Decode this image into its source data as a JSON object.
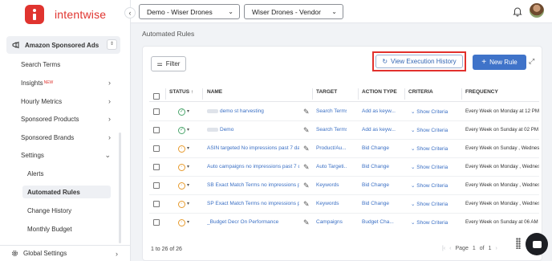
{
  "brand": {
    "name": "intentwise",
    "color": "#e0342f"
  },
  "sidebar": {
    "section_title": "Amazon Sponsored Ads",
    "items": [
      {
        "label": "Search Terms",
        "badge": "",
        "has_chevron": false
      },
      {
        "label": "Insights",
        "badge": "NEW",
        "has_chevron": true
      },
      {
        "label": "Hourly Metrics",
        "badge": "",
        "has_chevron": true
      },
      {
        "label": "Sponsored Products",
        "badge": "",
        "has_chevron": true
      },
      {
        "label": "Sponsored Brands",
        "badge": "",
        "has_chevron": true
      },
      {
        "label": "Settings",
        "badge": "",
        "has_chevron": true
      }
    ],
    "settings_subitems": [
      {
        "label": "Alerts",
        "active": false
      },
      {
        "label": "Automated Rules",
        "active": true
      },
      {
        "label": "Change History",
        "active": false
      },
      {
        "label": "Monthly Budget",
        "active": false
      }
    ],
    "bottom": {
      "label": "Global Settings"
    }
  },
  "topbar": {
    "account_select": "Demo - Wiser Drones",
    "profile_select": "Wiser Drones - Vendor"
  },
  "page": {
    "title": "Automated Rules"
  },
  "toolbar": {
    "filter_label": "Filter",
    "exec_history_label": "View Execution History",
    "new_rule_label": "New Rule",
    "accent": "#3f73c9",
    "highlight_color": "#e2312d"
  },
  "table": {
    "headers": {
      "status": "STATUS",
      "name": "NAME",
      "target": "TARGET",
      "action_type": "ACTION TYPE",
      "criteria": "CRITERIA",
      "frequency": "FREQUENCY"
    },
    "rows": [
      {
        "status": "check",
        "name": "demo st harvesting",
        "target": "Search Terms",
        "action": "Add as keyw...",
        "criteria": "Show Criteria",
        "frequency": "Every Week on Monday at 12 PM"
      },
      {
        "status": "check",
        "name": "Demo",
        "target": "Search Terms",
        "action": "Add as keyw...",
        "criteria": "Show Criteria",
        "frequency": "Every Week on Sunday at 02 PM"
      },
      {
        "status": "pause",
        "name": "ASIN targeted No impressions past 7 days, i",
        "target": "Product/Au...",
        "action": "Bid Change",
        "criteria": "Show Criteria",
        "frequency": "Every Week on Sunday , Wednesda..."
      },
      {
        "status": "pause",
        "name": "Auto campaigns no impressions past 7 days,...",
        "target": "Auto Targeti...",
        "action": "Bid Change",
        "criteria": "Show Criteria",
        "frequency": "Every Week on Monday , Wednesda..."
      },
      {
        "status": "pause",
        "name": "SB Exact Match Terms no impressions past ...",
        "target": "Keywords",
        "action": "Bid Change",
        "criteria": "Show Criteria",
        "frequency": "Every Week on Monday , Wednesda..."
      },
      {
        "status": "pause",
        "name": "SP Exact Match Terms no impressions past ...",
        "target": "Keywords",
        "action": "Bid Change",
        "criteria": "Show Criteria",
        "frequency": "Every Week on Monday , Wednesda..."
      },
      {
        "status": "pause",
        "name": "_Budget Decr On Performance",
        "target": "Campaigns",
        "action": "Budget Cha...",
        "criteria": "Show Criteria",
        "frequency": "Every Week on Sunday at 06 AM"
      }
    ]
  },
  "footer": {
    "count_label": "1 to 26 of 26",
    "page_label": "Page",
    "page_current": "1",
    "page_of": "of",
    "page_total": "1"
  }
}
